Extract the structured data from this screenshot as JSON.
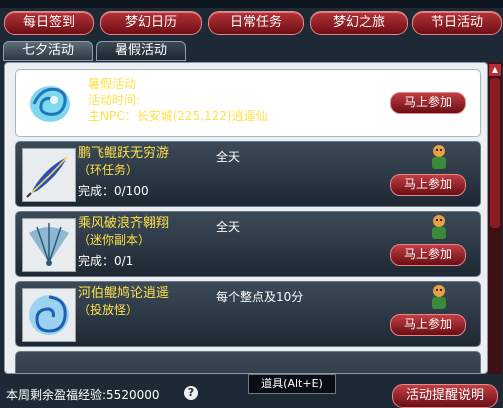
{
  "nav": {
    "tabs": [
      {
        "label": "每日签到"
      },
      {
        "label": "梦幻日历"
      },
      {
        "label": "日常任务"
      },
      {
        "label": "梦幻之旅"
      },
      {
        "label": "节日活动"
      }
    ]
  },
  "subtabs": [
    {
      "label": "七夕活动"
    },
    {
      "label": "暑假活动"
    }
  ],
  "featured": {
    "title": "暑假活动",
    "time_label": "活动时间:",
    "npc": "主NPC：长安城(225,122)逍遥仙",
    "button": "马上参加"
  },
  "activities": [
    {
      "title": "鹏飞鲲跃无穷游",
      "subtitle": "（环任务）",
      "progress": "完成：0/100",
      "time": "全天",
      "button": "马上参加",
      "icon": "feather-icon"
    },
    {
      "title": "乘风破浪齐翱翔",
      "subtitle": "（迷你副本）",
      "progress": "完成：0/1",
      "time": "全天",
      "button": "马上参加",
      "icon": "fan-icon"
    },
    {
      "title": "河伯鲲鸠论逍遥",
      "subtitle": "（投放怪）",
      "progress": "",
      "time": "每个整点及10分",
      "button": "马上参加",
      "icon": "whirlpool-icon"
    }
  ],
  "footer": {
    "remaining_label": "本周剩余盈福经验:5520000",
    "help": "?",
    "items_tip": "道具(Alt+E)",
    "remind_button": "活动提醒说明"
  }
}
